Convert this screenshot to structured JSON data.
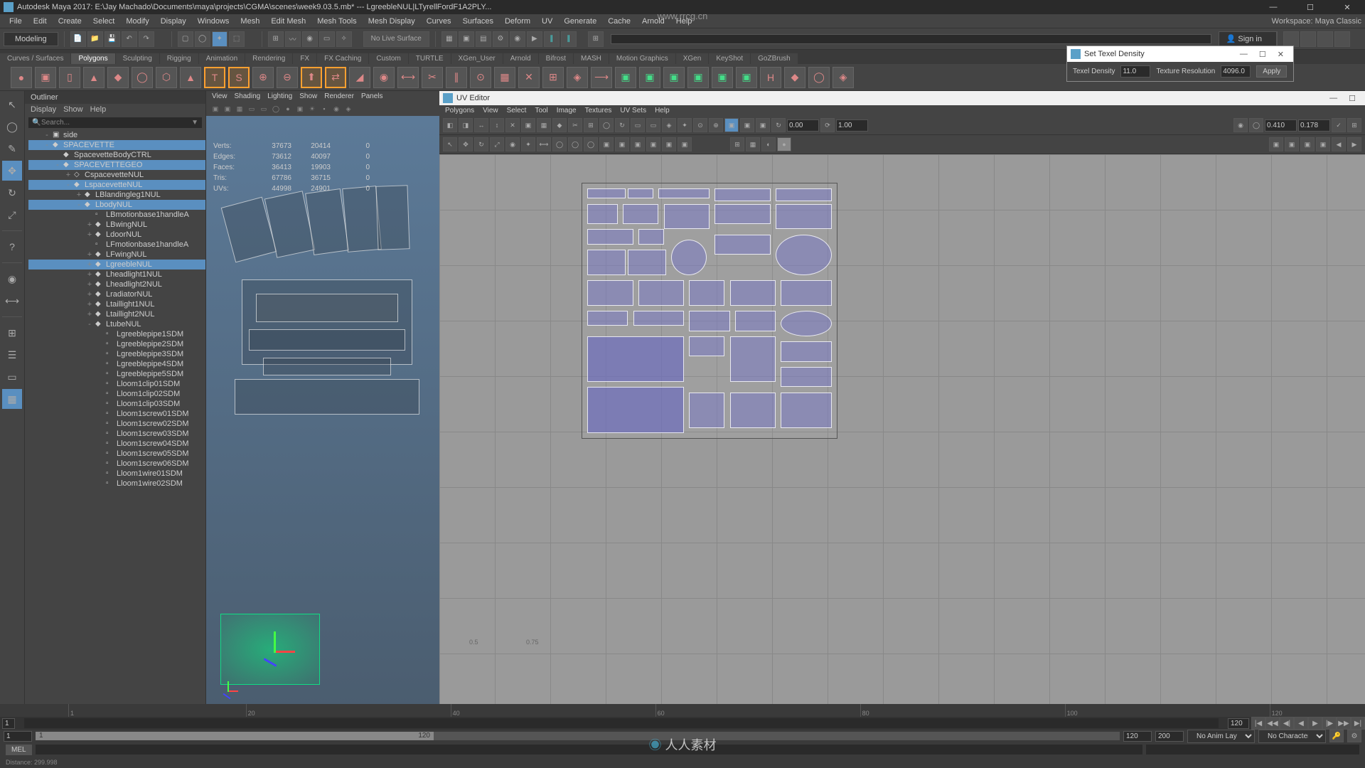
{
  "title": "Autodesk Maya 2017: E:\\Jay Machado\\Documents\\maya\\projects\\CGMA\\scenes\\week9.03.5.mb*  ---  LgreebleNUL|LTyrellFordF1A2PLY...",
  "menubar": [
    "File",
    "Edit",
    "Create",
    "Select",
    "Modify",
    "Display",
    "Windows",
    "Mesh",
    "Edit Mesh",
    "Mesh Tools",
    "Mesh Display",
    "Curves",
    "Surfaces",
    "Deform",
    "UV",
    "Generate",
    "Cache",
    "Arnold",
    "Help"
  ],
  "workspace_label": "Workspace:",
  "workspace_value": "Maya Classic",
  "mode": "Modeling",
  "live_surface": "No Live Surface",
  "signin": "👤 Sign in",
  "shelf_tabs": [
    "Curves / Surfaces",
    "Polygons",
    "Sculpting",
    "Rigging",
    "Animation",
    "Rendering",
    "FX",
    "FX Caching",
    "Custom",
    "TURTLE",
    "XGen_User",
    "Arnold",
    "Bifrost",
    "MASH",
    "Motion Graphics",
    "XGen",
    "KeyShot",
    "GoZBrush"
  ],
  "texel": {
    "title": "Set Texel Density",
    "density_label": "Texel Density",
    "density_val": "11.0",
    "res_label": "Texture Resolution",
    "res_val": "4096.0",
    "apply": "Apply"
  },
  "outliner": {
    "title": "Outliner",
    "menu": [
      "Display",
      "Show",
      "Help"
    ],
    "search": "Search...",
    "items": [
      {
        "indent": 1,
        "expand": "-",
        "icon": "▣",
        "label": "side",
        "sel": false
      },
      {
        "indent": 1,
        "expand": "-",
        "icon": "◆",
        "label": "SPACEVETTE",
        "sel": true
      },
      {
        "indent": 2,
        "expand": "",
        "icon": "◆",
        "label": "SpacevetteBodyCTRL",
        "sel": false
      },
      {
        "indent": 2,
        "expand": "-",
        "icon": "◆",
        "label": "SPACEVETTEGEO",
        "sel": true
      },
      {
        "indent": 3,
        "expand": "+",
        "icon": "◇",
        "label": "CspacevetteNUL",
        "sel": false
      },
      {
        "indent": 3,
        "expand": "-",
        "icon": "◆",
        "label": "LspacevetteNUL",
        "sel": true
      },
      {
        "indent": 4,
        "expand": "+",
        "icon": "◆",
        "label": "LBlandingleg1NUL",
        "sel": false
      },
      {
        "indent": 4,
        "expand": "-",
        "icon": "◆",
        "label": "LbodyNUL",
        "sel": true
      },
      {
        "indent": 5,
        "expand": "",
        "icon": "▫",
        "label": "LBmotionbase1handleA",
        "sel": false
      },
      {
        "indent": 5,
        "expand": "+",
        "icon": "◆",
        "label": "LBwingNUL",
        "sel": false
      },
      {
        "indent": 5,
        "expand": "+",
        "icon": "◆",
        "label": "LdoorNUL",
        "sel": false
      },
      {
        "indent": 5,
        "expand": "",
        "icon": "▫",
        "label": "LFmotionbase1handleA",
        "sel": false
      },
      {
        "indent": 5,
        "expand": "+",
        "icon": "◆",
        "label": "LFwingNUL",
        "sel": false
      },
      {
        "indent": 5,
        "expand": "+",
        "icon": "◆",
        "label": "LgreebleNUL",
        "sel": true
      },
      {
        "indent": 5,
        "expand": "+",
        "icon": "◆",
        "label": "Lheadlight1NUL",
        "sel": false
      },
      {
        "indent": 5,
        "expand": "+",
        "icon": "◆",
        "label": "Lheadlight2NUL",
        "sel": false
      },
      {
        "indent": 5,
        "expand": "+",
        "icon": "◆",
        "label": "LradiatorNUL",
        "sel": false
      },
      {
        "indent": 5,
        "expand": "+",
        "icon": "◆",
        "label": "Ltaillight1NUL",
        "sel": false
      },
      {
        "indent": 5,
        "expand": "+",
        "icon": "◆",
        "label": "Ltaillight2NUL",
        "sel": false
      },
      {
        "indent": 5,
        "expand": "-",
        "icon": "◆",
        "label": "LtubeNUL",
        "sel": false
      },
      {
        "indent": 6,
        "expand": "",
        "icon": "▫",
        "label": "Lgreeblepipe1SDM",
        "sel": false
      },
      {
        "indent": 6,
        "expand": "",
        "icon": "▫",
        "label": "Lgreeblepipe2SDM",
        "sel": false
      },
      {
        "indent": 6,
        "expand": "",
        "icon": "▫",
        "label": "Lgreeblepipe3SDM",
        "sel": false
      },
      {
        "indent": 6,
        "expand": "",
        "icon": "▫",
        "label": "Lgreeblepipe4SDM",
        "sel": false
      },
      {
        "indent": 6,
        "expand": "",
        "icon": "▫",
        "label": "Lgreeblepipe5SDM",
        "sel": false
      },
      {
        "indent": 6,
        "expand": "",
        "icon": "▫",
        "label": "Lloom1clip01SDM",
        "sel": false
      },
      {
        "indent": 6,
        "expand": "",
        "icon": "▫",
        "label": "Lloom1clip02SDM",
        "sel": false
      },
      {
        "indent": 6,
        "expand": "",
        "icon": "▫",
        "label": "Lloom1clip03SDM",
        "sel": false
      },
      {
        "indent": 6,
        "expand": "",
        "icon": "▫",
        "label": "Lloom1screw01SDM",
        "sel": false
      },
      {
        "indent": 6,
        "expand": "",
        "icon": "▫",
        "label": "Lloom1screw02SDM",
        "sel": false
      },
      {
        "indent": 6,
        "expand": "",
        "icon": "▫",
        "label": "Lloom1screw03SDM",
        "sel": false
      },
      {
        "indent": 6,
        "expand": "",
        "icon": "▫",
        "label": "Lloom1screw04SDM",
        "sel": false
      },
      {
        "indent": 6,
        "expand": "",
        "icon": "▫",
        "label": "Lloom1screw05SDM",
        "sel": false
      },
      {
        "indent": 6,
        "expand": "",
        "icon": "▫",
        "label": "Lloom1screw06SDM",
        "sel": false
      },
      {
        "indent": 6,
        "expand": "",
        "icon": "▫",
        "label": "Lloom1wire01SDM",
        "sel": false
      },
      {
        "indent": 6,
        "expand": "",
        "icon": "▫",
        "label": "Lloom1wire02SDM",
        "sel": false
      }
    ]
  },
  "viewport": {
    "menu": [
      "View",
      "Shading",
      "Lighting",
      "Show",
      "Renderer",
      "Panels"
    ],
    "stats": [
      {
        "label": "Verts:",
        "a": "37673",
        "b": "20414",
        "c": "0"
      },
      {
        "label": "Edges:",
        "a": "73612",
        "b": "40097",
        "c": "0"
      },
      {
        "label": "Faces:",
        "a": "36413",
        "b": "19903",
        "c": "0"
      },
      {
        "label": "Tris:",
        "a": "67786",
        "b": "36715",
        "c": "0"
      },
      {
        "label": "UVs:",
        "a": "44998",
        "b": "24901",
        "c": "0"
      }
    ]
  },
  "uv": {
    "title": "UV Editor",
    "menu": [
      "Polygons",
      "View",
      "Select",
      "Tool",
      "Image",
      "Textures",
      "UV Sets",
      "Help"
    ],
    "val1": "0.00",
    "val2": "1.00",
    "val3": "0.410",
    "val4": "0.178"
  },
  "timeline": {
    "marks": [
      "1",
      "20",
      "40",
      "60",
      "80",
      "100",
      "120"
    ],
    "current": "1",
    "slider_val": "1",
    "end": "120",
    "range_start": "1",
    "range_end": "120",
    "total_end": "200",
    "anim_layer": "No Anim Layer",
    "char_set": "No Character Set"
  },
  "cmd": {
    "label": "MEL",
    "status": "Distance:   299.998"
  },
  "watermark_url": "www.rrcg.cn"
}
